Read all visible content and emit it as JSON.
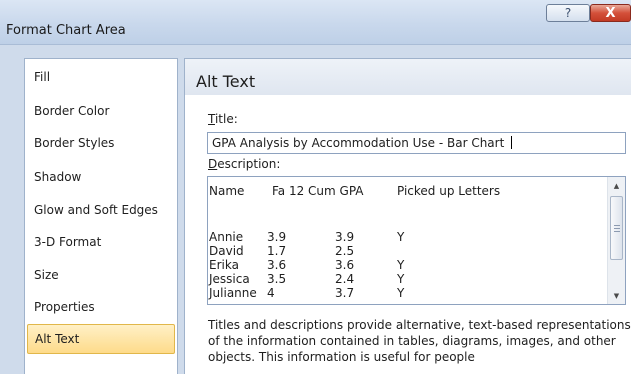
{
  "window": {
    "title": "Format Chart Area",
    "help_label": "?",
    "close_label": "X"
  },
  "nav": {
    "items": [
      {
        "label": "Fill"
      },
      {
        "label": "Border Color"
      },
      {
        "label": "Border Styles"
      },
      {
        "label": "Shadow"
      },
      {
        "label": "Glow and Soft Edges"
      },
      {
        "label": "3-D Format"
      },
      {
        "label": "Size"
      },
      {
        "label": "Properties"
      },
      {
        "label": "Alt Text",
        "selected": true
      }
    ]
  },
  "alt_text": {
    "heading": "Alt Text",
    "title_label": "Title:",
    "title_value": "GPA Analysis by Accommodation Use - Bar Chart ",
    "description_label": "Description:",
    "description": {
      "headers": [
        "Name",
        "Fa 12 Cum GPA",
        "Picked up Letters"
      ],
      "rows": [
        [
          "Annie",
          "3.9",
          "3.9",
          "Y"
        ],
        [
          "David",
          "1.7",
          "2.5",
          ""
        ],
        [
          "Erika",
          "3.6",
          "3.6",
          "Y"
        ],
        [
          "Jessica",
          "3.5",
          "2.4",
          "Y"
        ],
        [
          "Julianne",
          "4",
          "3.7",
          "Y"
        ]
      ]
    },
    "help_text": "Titles and descriptions provide alternative, text-based representations of the information contained in tables, diagrams, images, and other objects. This information is useful for people"
  },
  "colors": {
    "selected_nav_bg": "#fedb8a",
    "close_button": "#d4503a"
  }
}
